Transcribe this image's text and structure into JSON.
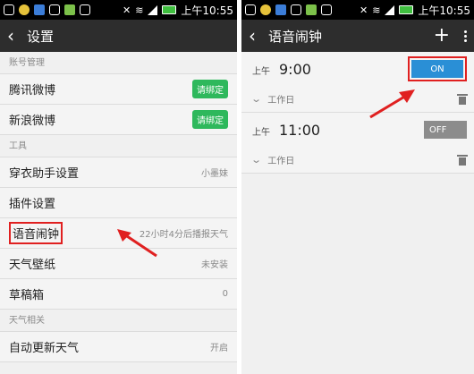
{
  "left": {
    "status": {
      "time": "上午10:55"
    },
    "appbar": {
      "title": "设置"
    },
    "sections": [
      {
        "header": "账号管理",
        "rows": [
          {
            "label": "腾讯微博",
            "badge": "请绑定"
          },
          {
            "label": "新浪微博",
            "badge": "请绑定"
          }
        ]
      },
      {
        "header": "工具",
        "rows": [
          {
            "label": "穿衣助手设置",
            "value": "小墨妹"
          },
          {
            "label": "插件设置",
            "value": ""
          },
          {
            "label": "语音闹钟",
            "value": "22小时4分后播报天气",
            "highlight": true
          },
          {
            "label": "天气壁纸",
            "value": "未安装"
          },
          {
            "label": "草稿箱",
            "value": "0"
          }
        ]
      },
      {
        "header": "天气相关",
        "rows": [
          {
            "label": "自动更新天气",
            "value": "开启"
          }
        ]
      }
    ]
  },
  "right": {
    "status": {
      "time": "上午10:55"
    },
    "appbar": {
      "title": "语音闹钟",
      "add_icon": "plus-icon",
      "menu_icon": "more-vertical-icon"
    },
    "alarms": [
      {
        "ampm": "上午",
        "time": "9:00",
        "toggle": "ON",
        "enabled": true,
        "repeat": "工作日",
        "highlight": true
      },
      {
        "ampm": "上午",
        "time": "11:00",
        "toggle": "OFF",
        "enabled": false,
        "repeat": "工作日"
      }
    ]
  },
  "colors": {
    "highlight": "#e02020",
    "badge": "#2eb85c",
    "toggle_on": "#2a8fd6",
    "toggle_off": "#8c8c8c",
    "appbar": "#2d2d2d"
  }
}
